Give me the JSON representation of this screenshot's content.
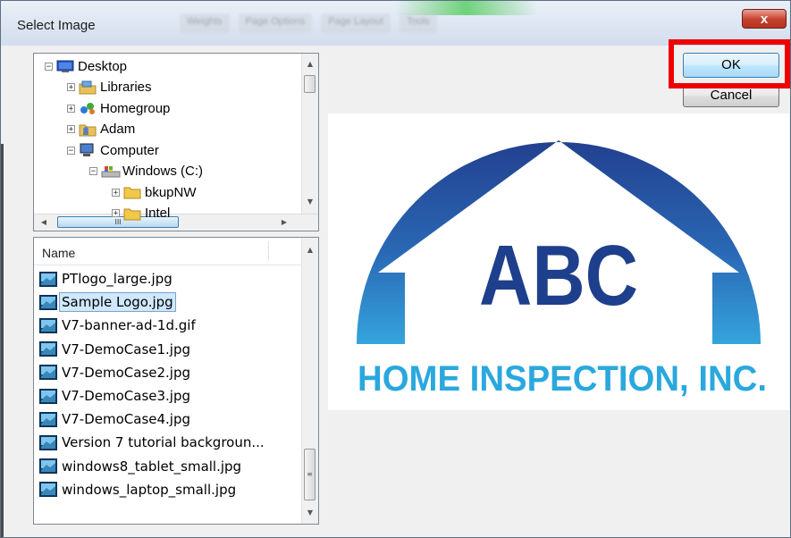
{
  "window": {
    "title": "Select Image",
    "close_glyph": "x"
  },
  "background_tabs": [
    "Weights",
    "Page Options",
    "Page Layout",
    "Tools"
  ],
  "tree": {
    "items": [
      {
        "label": "Desktop",
        "icon": "desktop-icon",
        "expander": "−",
        "level": 0
      },
      {
        "label": "Libraries",
        "icon": "libraries-icon",
        "expander": "+",
        "level": 1
      },
      {
        "label": "Homegroup",
        "icon": "homegroup-icon",
        "expander": "+",
        "level": 1
      },
      {
        "label": "Adam",
        "icon": "user-folder-icon",
        "expander": "+",
        "level": 1
      },
      {
        "label": "Computer",
        "icon": "computer-icon",
        "expander": "−",
        "level": 1
      },
      {
        "label": "Windows (C:)",
        "icon": "drive-icon",
        "expander": "−",
        "level": 2
      },
      {
        "label": "bkupNW",
        "icon": "folder-icon",
        "expander": "+",
        "level": 3
      },
      {
        "label": "Intel",
        "icon": "folder-icon",
        "expander": "+",
        "level": 3
      }
    ],
    "hscroll_grip": "III"
  },
  "file_list": {
    "header": "Name",
    "items": [
      {
        "name": "PTlogo_large.jpg",
        "selected": false
      },
      {
        "name": "Sample Logo.jpg",
        "selected": true
      },
      {
        "name": "V7-banner-ad-1d.gif",
        "selected": false
      },
      {
        "name": "V7-DemoCase1.jpg",
        "selected": false
      },
      {
        "name": "V7-DemoCase2.jpg",
        "selected": false
      },
      {
        "name": "V7-DemoCase3.jpg",
        "selected": false
      },
      {
        "name": "V7-DemoCase4.jpg",
        "selected": false
      },
      {
        "name": "Version 7 tutorial backgroun...",
        "selected": false
      },
      {
        "name": "windows8_tablet_small.jpg",
        "selected": false
      },
      {
        "name": "windows_laptop_small.jpg",
        "selected": false
      }
    ]
  },
  "buttons": {
    "ok": "OK",
    "cancel": "Cancel"
  },
  "preview": {
    "logo_text": "ABC",
    "logo_subtext": "HOME INSPECTION, INC.",
    "colors": {
      "dark_blue": "#1e3f8c",
      "light_blue": "#2aa8de"
    }
  }
}
